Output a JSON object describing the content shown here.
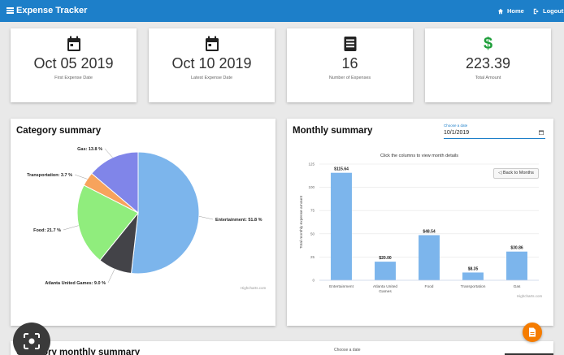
{
  "app": {
    "title": "Expense Tracker",
    "nav": [
      {
        "label": "Home",
        "icon": "home-icon"
      },
      {
        "label": "Logout",
        "icon": "logout-icon"
      }
    ],
    "bar_color": "#1d7fc9"
  },
  "stats": [
    {
      "value": "Oct 05 2019",
      "label": "First Expense Date",
      "icon": "calendar-icon"
    },
    {
      "value": "Oct 10 2019",
      "label": "Latest Expense Date",
      "icon": "calendar-icon"
    },
    {
      "value": "16",
      "label": "Number of Expenses",
      "icon": "list-icon"
    },
    {
      "value": "223.39",
      "label": "Total Amount",
      "icon": "dollar-icon"
    }
  ],
  "category_summary": {
    "title": "Category summary",
    "credits": "Highcharts.com"
  },
  "monthly_summary": {
    "title": "Monthly summary",
    "date_label": "Choose a date",
    "date_value": "10/1/2019",
    "back_button": "◁ Back to Months",
    "credits": "Highcharts.com"
  },
  "bottom": {
    "title": "Category monthly summary",
    "date_label": "Choose a date"
  },
  "chart_data": [
    {
      "type": "pie",
      "title": "Category summary",
      "slices": [
        {
          "name": "Entertainment",
          "label": "Entertainment: 51.8 %",
          "value": 51.8,
          "color": "#7cb5ec"
        },
        {
          "name": "Atlanta United Games",
          "label": "Atlanta United Games: 9.0 %",
          "value": 9.0,
          "color": "#434348"
        },
        {
          "name": "Food",
          "label": "Food: 21.7 %",
          "value": 21.7,
          "color": "#90ed7d"
        },
        {
          "name": "Transportation",
          "label": "Transportation: 3.7 %",
          "value": 3.7,
          "color": "#f7a35c"
        },
        {
          "name": "Gas",
          "label": "Gas: 13.8 %",
          "value": 13.8,
          "color": "#8085e9"
        }
      ]
    },
    {
      "type": "bar",
      "subtitle": "Click the columns to view month details",
      "ylabel": "Total monthly expense amount",
      "ylim": [
        0,
        125
      ],
      "yticks": [
        0,
        25,
        50,
        75,
        100,
        125
      ],
      "categories": [
        "Entertainment",
        "Atlanta United Games",
        "Food",
        "Transportation",
        "Gas"
      ],
      "values": [
        115.64,
        20.0,
        48.54,
        8.35,
        30.86
      ],
      "value_labels": [
        "$115.64",
        "$20.00",
        "$48.54",
        "$8.35",
        "$30.86"
      ],
      "color": "#7cb5ec"
    }
  ]
}
